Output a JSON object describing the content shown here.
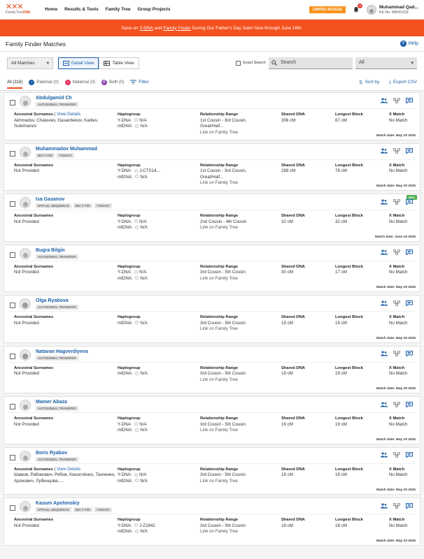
{
  "nav": {
    "logo_text_a": "FamilyTree",
    "logo_text_b": "DNA",
    "links": [
      "Home",
      "Results & Tools",
      "Family Tree",
      "Group Projects"
    ],
    "limited": "LIMITED ACCESS",
    "bell_count": "3",
    "user_name": "Muhammad Qad...",
    "kit": "Kit No. MK00103"
  },
  "banner": {
    "pre": "Save on ",
    "ydna": "Y-DNA",
    "mid": " and ",
    "ff": "Family Finder",
    "post": " During Our Father's Day Sale! Now through June 16th."
  },
  "page": {
    "title": "Family Finder Matches",
    "help": "Help"
  },
  "toolbar": {
    "matches": "All Matches",
    "detail": "Detail View",
    "table": "Table View",
    "exact": "Exact Search",
    "search_placeholder": "Search",
    "filter_select": "All"
  },
  "filters": {
    "all": "All (318)",
    "paternal": "Paternal (0)",
    "maternal": "Maternal (0)",
    "both": "Both (0)",
    "filter": "Filter",
    "sort": "Sort by",
    "export": "Export CSV"
  },
  "labels": {
    "surnames": "Ancestral Surnames",
    "view_details": "View Details",
    "haplogroup": "Haplogroup",
    "ydna": "Y-DNA:",
    "mtdna": "mtDNA:",
    "rel": "Relationship Range",
    "link_tree": "Link on Family Tree",
    "shared": "Shared DNA",
    "longest": "Longest Block",
    "xmatch": "X Match",
    "new": "NEW"
  },
  "matches": [
    {
      "name": "Abdulgamid Ch",
      "tags": [
        "AUTOSOMAL TRANSFER"
      ],
      "details": true,
      "surnames": "Akhmedov, Chalaviev, Gasanbekov, Kadiev, Suleimanov",
      "ydna": "N/A",
      "mtdna": "N/A",
      "rel1": "1st Cousin - 3rd Cousin,",
      "rel2": "Great/Half...",
      "shared": "306 cM",
      "longest": "67 cM",
      "x": "No Match",
      "date": "Match date: May 20 2025",
      "female": false,
      "new": false
    },
    {
      "name": "Muhammadov Muhammad",
      "tags": [
        "BIG Y-700",
        "Y-DNA37"
      ],
      "details": false,
      "surnames": "Not Provided",
      "ydna": "J-CTS14...",
      "mtdna": "N/A",
      "rel1": "1st Cousin - 3rd Cousin,",
      "rel2": "Great/Half...",
      "shared": "289 cM",
      "longest": "76 cM",
      "x": "No Match",
      "date": "Match date: May 20 2025",
      "female": false,
      "new": false
    },
    {
      "name": "Isa Gasanov",
      "tags": [
        "MTFULL SEQUENCE",
        "BIG Y-700",
        "Y-DNA37"
      ],
      "details": false,
      "surnames": "Not Provided",
      "ydna": "N/A",
      "mtdna": "N/A",
      "rel1": "2nd Cousin - 4th Cousin",
      "rel2": "",
      "shared": "32 cM",
      "longest": "32 cM",
      "x": "No Match",
      "date": "Match date: June 16 2025",
      "female": false,
      "new": true
    },
    {
      "name": "Bugra Bilgin",
      "tags": [
        "AUTOSOMAL TRANSFER"
      ],
      "details": false,
      "surnames": "Not Provided",
      "ydna": "N/A",
      "mtdna": "N/A",
      "rel1": "3rd Cousin - 5th Cousin",
      "rel2": "",
      "shared": "30 cM",
      "longest": "17 cM",
      "x": "No Match",
      "date": "Match date: May 20 2025",
      "female": false,
      "new": false
    },
    {
      "name": "Olga Ryabova",
      "tags": [
        "AUTOSOMAL TRANSFER"
      ],
      "details": false,
      "surnames": "Not Provided",
      "ydna": "",
      "mtdna": "N/A",
      "rel1": "3rd Cousin - 5th Cousin",
      "rel2": "",
      "shared": "19 cM",
      "longest": "19 cM",
      "x": "No Match",
      "date": "Match date: May 20 2025",
      "female": true,
      "new": false
    },
    {
      "name": "Natavan Hagverdiyeva",
      "tags": [
        "AUTOSOMAL TRANSFER"
      ],
      "details": false,
      "surnames": "Not Provided",
      "ydna": "",
      "mtdna": "N/A",
      "rel1": "3rd Cousin - 5th Cousin",
      "rel2": "",
      "shared": "19 cM",
      "longest": "19 cM",
      "x": "No Match",
      "date": "Match date: May 20 2025",
      "female": true,
      "new": false
    },
    {
      "name": "Mamer Abaza",
      "tags": [
        "AUTOSOMAL TRANSFER"
      ],
      "details": false,
      "surnames": "Not Provided",
      "ydna": "N/A",
      "mtdna": "N/A",
      "rel1": "3rd Cousin - 5th Cousin",
      "rel2": "",
      "shared": "19 cM",
      "longest": "19 cM",
      "x": "No Match",
      "date": "Match date: May 20 2025",
      "female": false,
      "new": false
    },
    {
      "name": "Boris Ryabov",
      "tags": [
        "AUTOSOMAL TRANSFER"
      ],
      "details": true,
      "surnames": "Шамов, Рабинович, Рябов, Коноплёнко, Танченко, Аронович, Лубенцова, ...",
      "ydna": "N/A",
      "mtdna": "N/A",
      "rel1": "3rd Cousin - 5th Cousin",
      "rel2": "",
      "shared": "18 cM",
      "longest": "18 cM",
      "x": "No Match",
      "date": "Match date: May 20 2025",
      "female": false,
      "new": false
    },
    {
      "name": "Kasum Apolonskiy",
      "tags": [
        "MTFULL SEQUENCE",
        "BIG Y-700",
        "Y-DNA37"
      ],
      "details": false,
      "surnames": "Not Provided",
      "ydna": "J-Z1842",
      "mtdna": "N/A",
      "rel1": "3rd Cousin - 5th Cousin",
      "rel2": "",
      "shared": "18 cM",
      "longest": "18 cM",
      "x": "No Match",
      "date": "Match date: May 20 2025",
      "female": false,
      "new": false
    }
  ],
  "colors": {
    "accent": "#1a5fa8",
    "banner": "#f4511e",
    "brand": "#e94e1b"
  }
}
